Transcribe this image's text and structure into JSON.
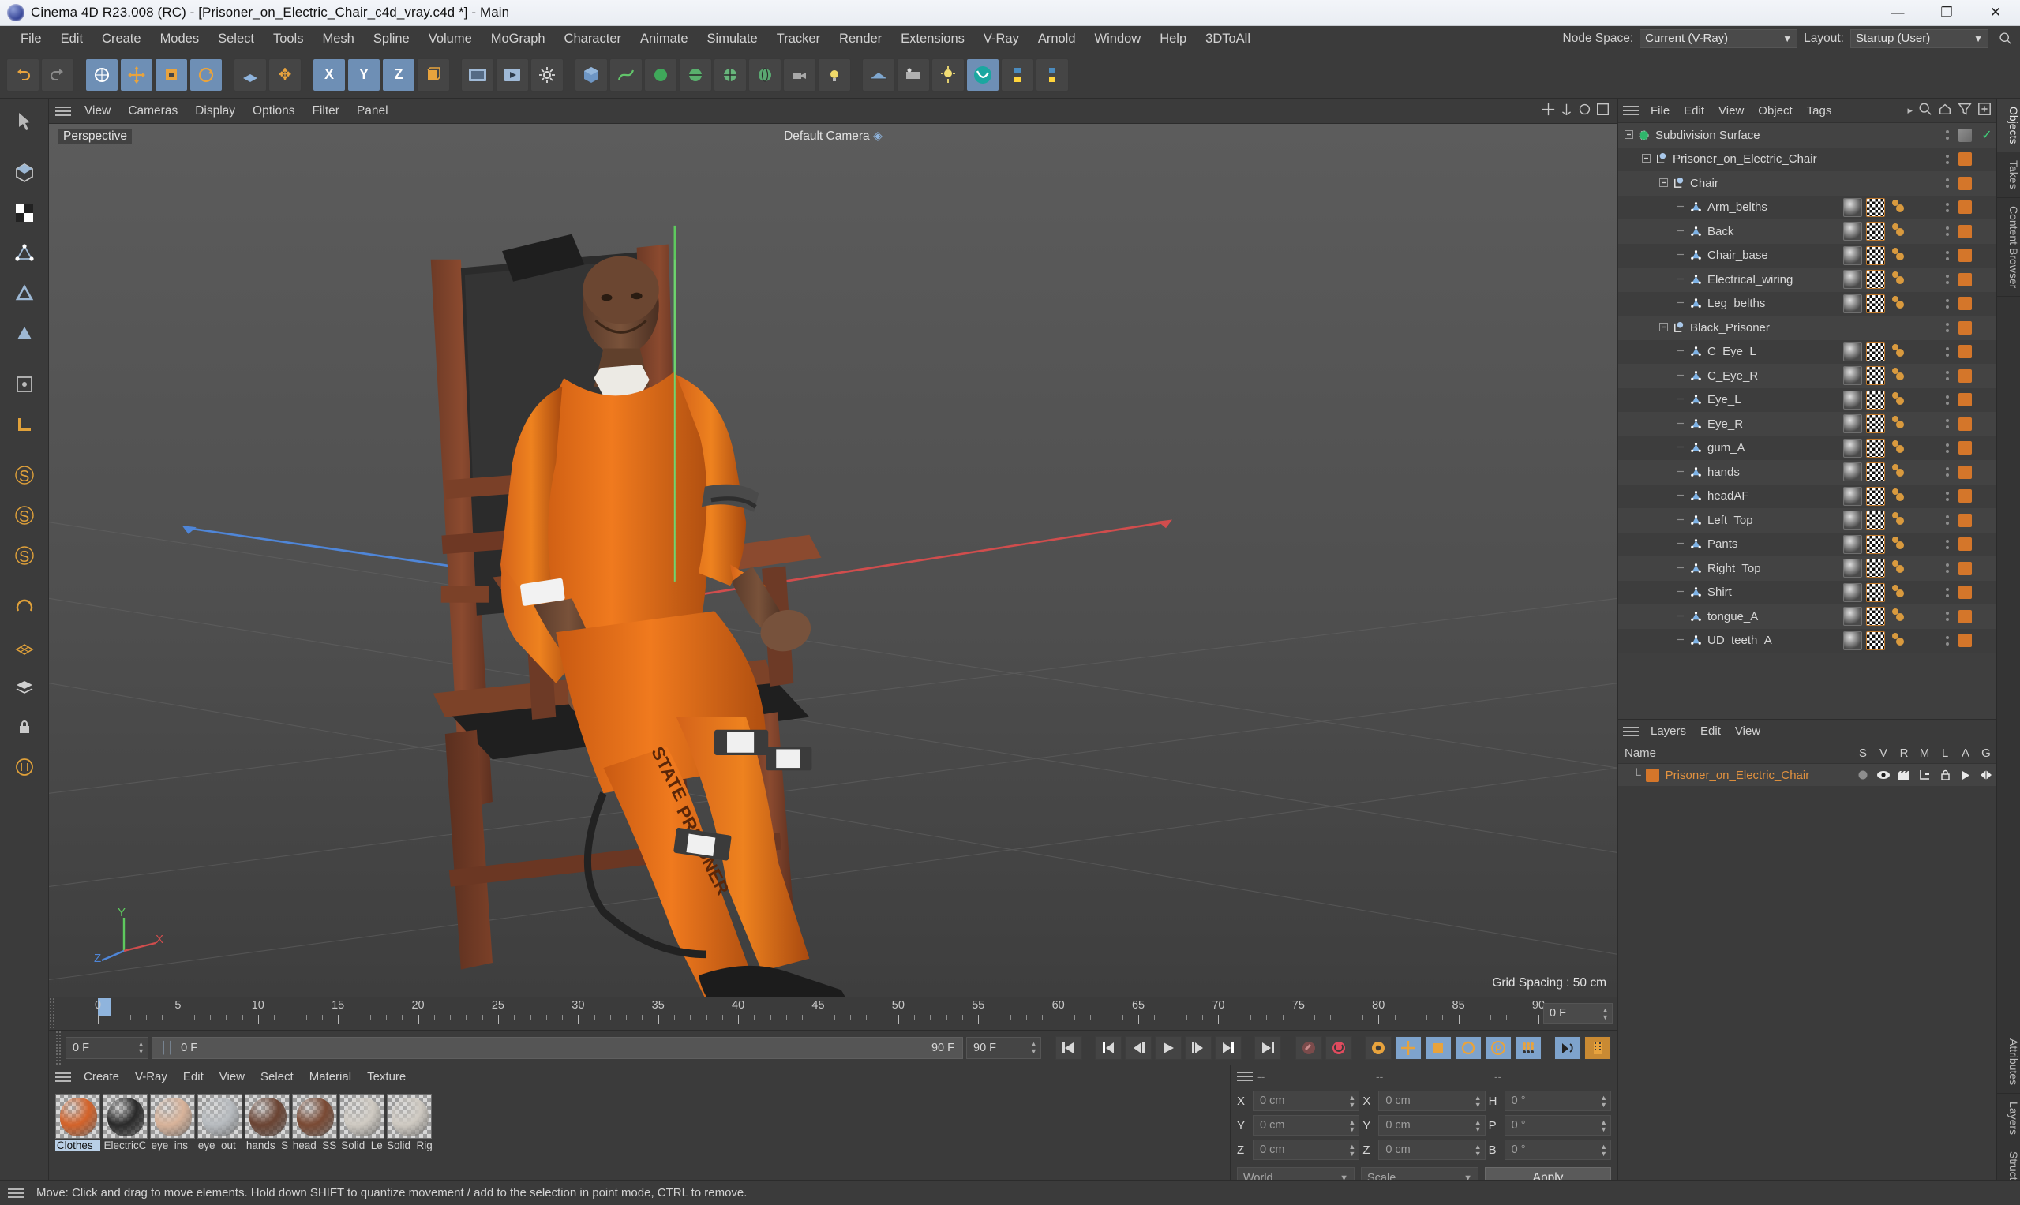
{
  "window": {
    "title": "Cinema 4D R23.008 (RC) - [Prisoner_on_Electric_Chair_c4d_vray.c4d *] - Main",
    "minimize": "—",
    "maximize": "❐",
    "close": "✕"
  },
  "menubar": {
    "items": [
      "File",
      "Edit",
      "Create",
      "Modes",
      "Select",
      "Tools",
      "Mesh",
      "Spline",
      "Volume",
      "MoGraph",
      "Character",
      "Animate",
      "Simulate",
      "Tracker",
      "Render",
      "Extensions",
      "V-Ray",
      "Arnold",
      "Window",
      "Help",
      "3DToAll"
    ],
    "node_space_label": "Node Space:",
    "node_space_value": "Current (V-Ray)",
    "layout_label": "Layout:",
    "layout_value": "Startup (User)",
    "search_icon": "search-icon"
  },
  "viewport": {
    "menu": [
      "View",
      "Cameras",
      "Display",
      "Options",
      "Filter",
      "Panel"
    ],
    "label": "Perspective",
    "camera": "Default Camera",
    "grid_spacing": "Grid Spacing : 50 cm",
    "axis_x": "X",
    "axis_y": "Y",
    "axis_z": "Z"
  },
  "timeline": {
    "ticks": [
      0,
      5,
      10,
      15,
      20,
      25,
      30,
      35,
      40,
      45,
      50,
      55,
      60,
      65,
      70,
      75,
      80,
      85,
      90
    ],
    "current_frame": "0 F",
    "end_frame_top": "0 F",
    "field_left": "0 F",
    "field_green": "0 F",
    "field_right": "90 F",
    "field_right2": "90 F"
  },
  "materials": {
    "menu": [
      "Create",
      "V-Ray",
      "Edit",
      "View",
      "Select",
      "Material",
      "Texture"
    ],
    "items": [
      {
        "name": "Clothes_",
        "color": "#d4632a",
        "selected": true
      },
      {
        "name": "ElectricC",
        "color": "#2a2a2a",
        "selected": false
      },
      {
        "name": "eye_ins_",
        "color": "#d8b39a",
        "selected": false
      },
      {
        "name": "eye_out_",
        "color": "#b8bcc0",
        "selected": false
      },
      {
        "name": "hands_S",
        "color": "#6b4433",
        "selected": false
      },
      {
        "name": "head_SS",
        "color": "#7a4a34",
        "selected": false
      },
      {
        "name": "Solid_Le",
        "color": "#cfcac2",
        "selected": false
      },
      {
        "name": "Solid_Rig",
        "color": "#cfcac2",
        "selected": false
      }
    ]
  },
  "coordinates": {
    "header": [
      "--",
      "--",
      "--"
    ],
    "rows": [
      {
        "label1": "X",
        "value1": "0 cm",
        "label2": "X",
        "value2": "0 cm",
        "label3": "H",
        "value3": "0 °"
      },
      {
        "label1": "Y",
        "value1": "0 cm",
        "label2": "Y",
        "value2": "0 cm",
        "label3": "P",
        "value3": "0 °"
      },
      {
        "label1": "Z",
        "value1": "0 cm",
        "label2": "Z",
        "value2": "0 cm",
        "label3": "B",
        "value3": "0 °"
      }
    ],
    "system": "World",
    "mode": "Scale",
    "apply": "Apply"
  },
  "object_manager": {
    "menu": [
      "File",
      "Edit",
      "View",
      "Object",
      "Tags"
    ],
    "more": "▸",
    "icons": [
      "search-icon",
      "home-icon",
      "filter-icon",
      "add-icon"
    ],
    "items": [
      {
        "name": "Subdivision Surface",
        "depth": 0,
        "icon": "generator",
        "tags": false,
        "check": true
      },
      {
        "name": "Prisoner_on_Electric_Chair",
        "depth": 1,
        "icon": "null",
        "tags": false
      },
      {
        "name": "Chair",
        "depth": 2,
        "icon": "null",
        "tags": false
      },
      {
        "name": "Arm_belths",
        "depth": 3,
        "icon": "poly",
        "tags": true
      },
      {
        "name": "Back",
        "depth": 3,
        "icon": "poly",
        "tags": true
      },
      {
        "name": "Chair_base",
        "depth": 3,
        "icon": "poly",
        "tags": true
      },
      {
        "name": "Electrical_wiring",
        "depth": 3,
        "icon": "poly",
        "tags": true
      },
      {
        "name": "Leg_belths",
        "depth": 3,
        "icon": "poly",
        "tags": true
      },
      {
        "name": "Black_Prisoner",
        "depth": 2,
        "icon": "null",
        "tags": false
      },
      {
        "name": "C_Eye_L",
        "depth": 3,
        "icon": "poly",
        "tags": true
      },
      {
        "name": "C_Eye_R",
        "depth": 3,
        "icon": "poly",
        "tags": true
      },
      {
        "name": "Eye_L",
        "depth": 3,
        "icon": "poly",
        "tags": true
      },
      {
        "name": "Eye_R",
        "depth": 3,
        "icon": "poly",
        "tags": true
      },
      {
        "name": "gum_A",
        "depth": 3,
        "icon": "poly",
        "tags": true
      },
      {
        "name": "hands",
        "depth": 3,
        "icon": "poly",
        "tags": true
      },
      {
        "name": "headAF",
        "depth": 3,
        "icon": "poly",
        "tags": true
      },
      {
        "name": "Left_Top",
        "depth": 3,
        "icon": "poly",
        "tags": true
      },
      {
        "name": "Pants",
        "depth": 3,
        "icon": "poly",
        "tags": true
      },
      {
        "name": "Right_Top",
        "depth": 3,
        "icon": "poly",
        "tags": true
      },
      {
        "name": "Shirt",
        "depth": 3,
        "icon": "poly",
        "tags": true
      },
      {
        "name": "tongue_A",
        "depth": 3,
        "icon": "poly",
        "tags": true
      },
      {
        "name": "UD_teeth_A",
        "depth": 3,
        "icon": "poly",
        "tags": true
      }
    ]
  },
  "layers_panel": {
    "menu": [
      "Layers",
      "Edit",
      "View"
    ],
    "name_header": "Name",
    "columns": [
      "S",
      "V",
      "R",
      "M",
      "L",
      "A",
      "G"
    ],
    "rows": [
      {
        "name": "Prisoner_on_Electric_Chair",
        "color": "#d4762a"
      }
    ]
  },
  "vertical_tabs_right": [
    "Objects",
    "Takes",
    "Content Browser"
  ],
  "vertical_tabs_far": [
    "Attributes",
    "Layers",
    "Structure"
  ],
  "statusbar": {
    "text": "Move: Click and drag to move elements. Hold down SHIFT to quantize movement / add to the selection in point mode, CTRL to remove."
  },
  "colors": {
    "accent_orange": "#d4762a",
    "panel_bg": "#3b3b3b",
    "tree_bg": "#3f3f3f",
    "highlight_blue": "#7ea3cc"
  }
}
